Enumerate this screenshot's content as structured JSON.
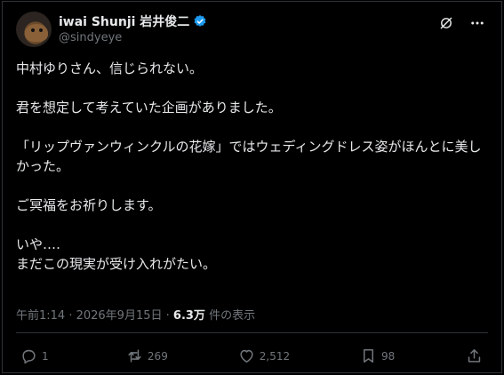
{
  "author": {
    "display_name": "iwai Shunji 岩井俊二",
    "handle": "@sindyeye"
  },
  "tweet": {
    "lines": [
      "中村ゆりさん、信じられない。",
      "君を想定して考えていた企画がありました。",
      "「リップヴァンウィンクルの花嫁」ではウェディングドレス姿がほんとに美しかった。",
      "ご冥福をお祈りします。",
      "いや‥‥",
      "まだこの現実が受け入れがたい。"
    ]
  },
  "meta": {
    "timestamp": "午前1:14 · 2026年9月15日",
    "separator": " · ",
    "views_count": "6.3万",
    "views_label": " 件の表示"
  },
  "actions": {
    "replies": "1",
    "reposts": "269",
    "likes": "2,512",
    "bookmarks": "98"
  },
  "icons": {
    "verified": "verified-badge-icon",
    "grok": "grok-icon",
    "more": "more-icon",
    "reply": "reply-icon",
    "repost": "repost-icon",
    "like": "heart-icon",
    "bookmark": "bookmark-icon",
    "share": "share-icon"
  },
  "colors": {
    "background": "#000000",
    "text": "#e7e9ea",
    "muted": "#71767b",
    "verified": "#1d9bf0",
    "border": "#2f3336"
  }
}
